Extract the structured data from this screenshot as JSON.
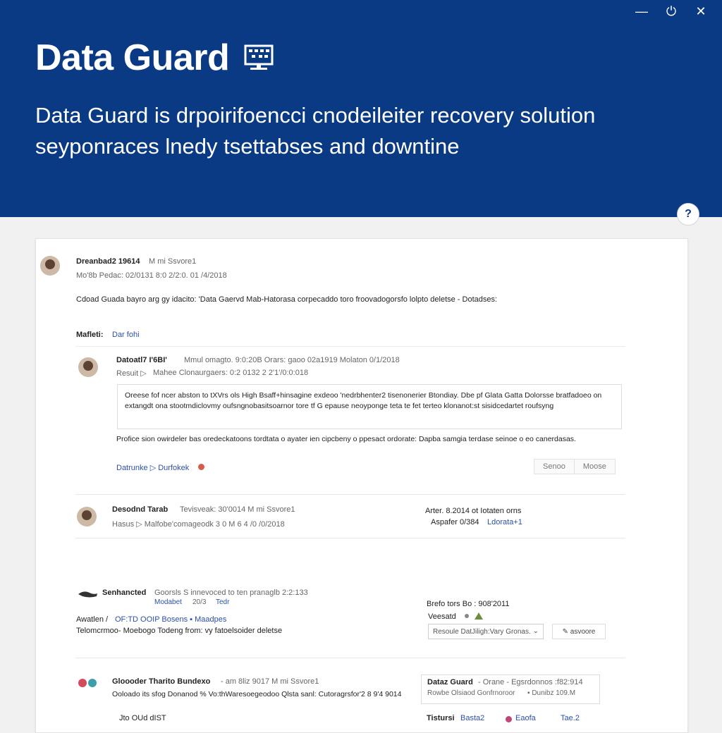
{
  "window": {
    "minimize": "—",
    "power": "⏻",
    "close": "✕"
  },
  "hero": {
    "title": "Data Guard",
    "subtitle": "Data Guard is drpoirifoencci cnodeileiter recovery solution seyponraces lnedy tsettabses and downtine"
  },
  "help": {
    "label": "?"
  },
  "post": {
    "author": "Dreanbad2 19614",
    "meta": "M mi Ssvore1",
    "date_line": "Mo'8b Pedac: 02/0131 8:0 2/2:0. 01 /4/2018",
    "body": "Cdoad Guada bayro arg gy idacito: 'Data Gaervd Mab-Hatorasa corpecaddo toro froovadogorsfo lolpto deletse - Dotadses:",
    "mention_label": "Mafleti:",
    "mention_link": "Dar fohi"
  },
  "reply1": {
    "author": "Datoatl7 I'6BI'",
    "meta": "Mmul omagto. 9:0:20B  Orars: gaoo  02a1919 Molaton 0/1/2018",
    "sub_prefix": "Resuit ▷",
    "sub": "Mahee Clonaurgaers: 0:2 0132 2 2'1'/0:0:018",
    "quote": "Oreese fof ncer abston to tXVrs ols High  Bsaff+hinsagine exdeoo 'nedrbhenter2 tisenonerier Btondiay.  Dbe pf Glata  Gatta Dolorsse bratfadoeo on extangdt ona stootmdiclovmy oufsngnobasitsoarnor tore tf G epause neoyponge teta te fet terteo klonanot:st sisidcedartet roufsyng",
    "note": "Profice sion owirdeler bas oredeckatoons tordtata o ayater ien cipcbeny o ppesact ordorate: Dapba samgia terdase seinoe o eo canerdasas.",
    "link_primary": "Datrunke ▷ Durfokek",
    "btn_secondary": "Senoo",
    "btn_primary": "Moose"
  },
  "reply2": {
    "author": "Desodnd Tarab",
    "meta": "Tevisveak: 30'0014 M mi Ssvore1",
    "sub": "Hasus ▷ Malfobe'comageodk 3 0 M 6 4 /0 /0/2018",
    "right_top": "Arter. 8.2014  ot Iotaten orns",
    "right_label": "Aspafer 0/384",
    "right_link": "Ldorata+1"
  },
  "reply3": {
    "author": "Senhancted",
    "meta": "Goorsls S innevoced to ten pranaglb 2:2:133",
    "sub_link1": "Modabet",
    "sub_date": "20/3",
    "sub_link2": "Tedr",
    "row_label": "Awatlen /",
    "row_link": "OF:TD OOIP Bosens ▪ Maadpes",
    "row2": "Telomcrmoo- Moebogo Todeng from: vy fatoelsoider deletse",
    "right_top": "Brefo tors Bo : 908'2011",
    "right_label": "Veesatd",
    "select_value": "Resoule DatJiligh:Vary Gronas.",
    "action": "✎ asvoore"
  },
  "reply4": {
    "author": "Gloooder Tharito Bundexo",
    "meta": "- am 8liz 9017 M mi Ssvore1",
    "sub": "Ooloado its sfog Donanod % Vo:thWaresoegeodoo Qlsta sanl: Cutoragrsfor'2 8 9'4 9014",
    "box_title": "Dataz Guard",
    "box_meta": "- Orane - Egsrdonnos :f82:914",
    "box_sub": "Rowbe Olsiaod Gonfrnoroor",
    "box_sub2": "▪ Dunibz 109.M",
    "foot_left": "Jto OUd dIST",
    "foot_label": "Tistursi",
    "foot_link": "Basta2",
    "foot_link2": "Eaofa",
    "foot_link3": "Tae.2"
  }
}
